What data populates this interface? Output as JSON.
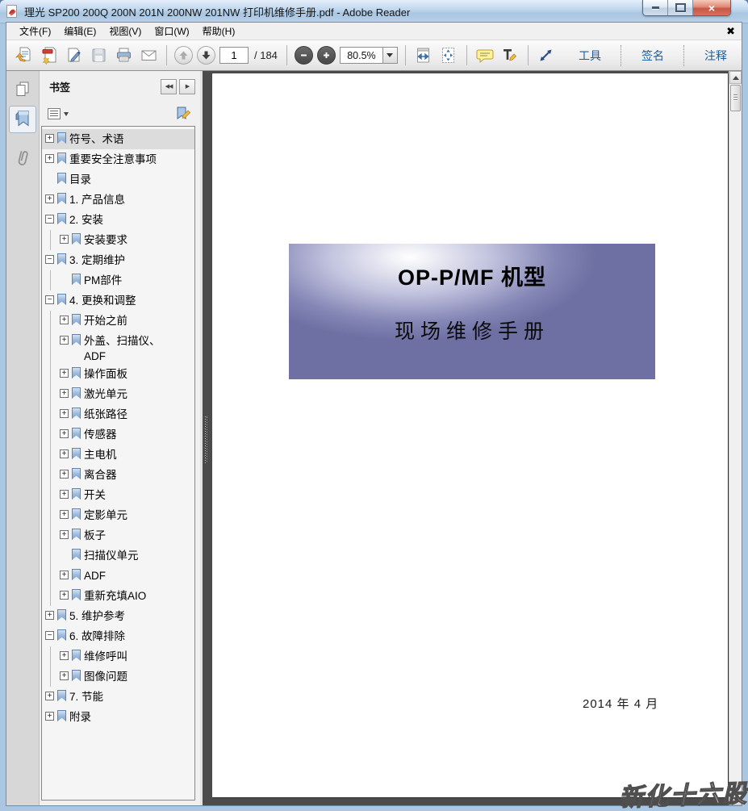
{
  "window": {
    "title": "理光 SP200 200Q 200N 201N 200NW 201NW 打印机维修手册.pdf - Adobe Reader",
    "controls": [
      "minimize",
      "maximize",
      "close"
    ]
  },
  "menu": {
    "items": [
      "文件(F)",
      "编辑(E)",
      "视图(V)",
      "窗口(W)",
      "帮助(H)"
    ],
    "close_glyph": "✖"
  },
  "toolbar": {
    "icon_names": [
      "open-file-icon",
      "create-pdf-icon",
      "sign-document-icon",
      "save-icon",
      "print-icon",
      "email-icon",
      "previous-page-icon",
      "next-page-icon",
      "zoom-out-icon",
      "zoom-in-icon",
      "fit-width-icon",
      "fit-page-icon",
      "comment-icon",
      "highlight-text-icon",
      "reading-mode-icon"
    ],
    "page_current": "1",
    "page_total_label": "/ 184",
    "zoom_value": "80.5%",
    "buttons": [
      "工具",
      "签名",
      "注释"
    ]
  },
  "nav_rail": {
    "icons": [
      "page-thumbnails-icon",
      "bookmarks-icon",
      "attachments-icon"
    ],
    "active": "bookmarks-icon"
  },
  "bookmarks": {
    "panel_title": "书签",
    "items": [
      {
        "label": "符号、术语",
        "level": 0,
        "toggle": "plus",
        "selected": true
      },
      {
        "label": "重要安全注意事项",
        "level": 0,
        "toggle": "plus"
      },
      {
        "label": "目录",
        "level": 0,
        "toggle": "none"
      },
      {
        "label": "1. 产品信息",
        "level": 0,
        "toggle": "plus"
      },
      {
        "label": "2. 安装",
        "level": 0,
        "toggle": "minus"
      },
      {
        "label": "安装要求",
        "level": 1,
        "toggle": "plus"
      },
      {
        "label": "3. 定期维护",
        "level": 0,
        "toggle": "minus"
      },
      {
        "label": "PM部件",
        "level": 1,
        "toggle": "none"
      },
      {
        "label": "4. 更换和调整",
        "level": 0,
        "toggle": "minus"
      },
      {
        "label": "开始之前",
        "level": 1,
        "toggle": "plus"
      },
      {
        "label": "外盖、扫描仪、\nADF",
        "level": 1,
        "toggle": "plus"
      },
      {
        "label": "操作面板",
        "level": 1,
        "toggle": "plus"
      },
      {
        "label": "激光单元",
        "level": 1,
        "toggle": "plus"
      },
      {
        "label": "纸张路径",
        "level": 1,
        "toggle": "plus"
      },
      {
        "label": "传感器",
        "level": 1,
        "toggle": "plus"
      },
      {
        "label": "主电机",
        "level": 1,
        "toggle": "plus"
      },
      {
        "label": "离合器",
        "level": 1,
        "toggle": "plus"
      },
      {
        "label": "开关",
        "level": 1,
        "toggle": "plus"
      },
      {
        "label": "定影单元",
        "level": 1,
        "toggle": "plus"
      },
      {
        "label": "板子",
        "level": 1,
        "toggle": "plus"
      },
      {
        "label": "扫描仪单元",
        "level": 1,
        "toggle": "none"
      },
      {
        "label": "ADF",
        "level": 1,
        "toggle": "plus"
      },
      {
        "label": "重新充填AIO",
        "level": 1,
        "toggle": "plus"
      },
      {
        "label": "5. 维护参考",
        "level": 0,
        "toggle": "plus"
      },
      {
        "label": "6. 故障排除",
        "level": 0,
        "toggle": "minus"
      },
      {
        "label": "维修呼叫",
        "level": 1,
        "toggle": "plus"
      },
      {
        "label": "图像问题",
        "level": 1,
        "toggle": "plus"
      },
      {
        "label": "7. 节能",
        "level": 0,
        "toggle": "plus"
      },
      {
        "label": "附录",
        "level": 0,
        "toggle": "plus"
      }
    ]
  },
  "document": {
    "banner_title": "OP-P/MF 机型",
    "banner_subtitle": "现场维修手册",
    "date_label": "2014 年 4 月",
    "watermark": "新化十六股"
  },
  "colors": {
    "accent_blue": "#1d5c9e",
    "banner_purple": "#6e70a4",
    "doc_pane_bg": "#4b4b4b",
    "titlebar_blue": "#b9d0e8",
    "comment_yellow": "#fff3a1"
  }
}
